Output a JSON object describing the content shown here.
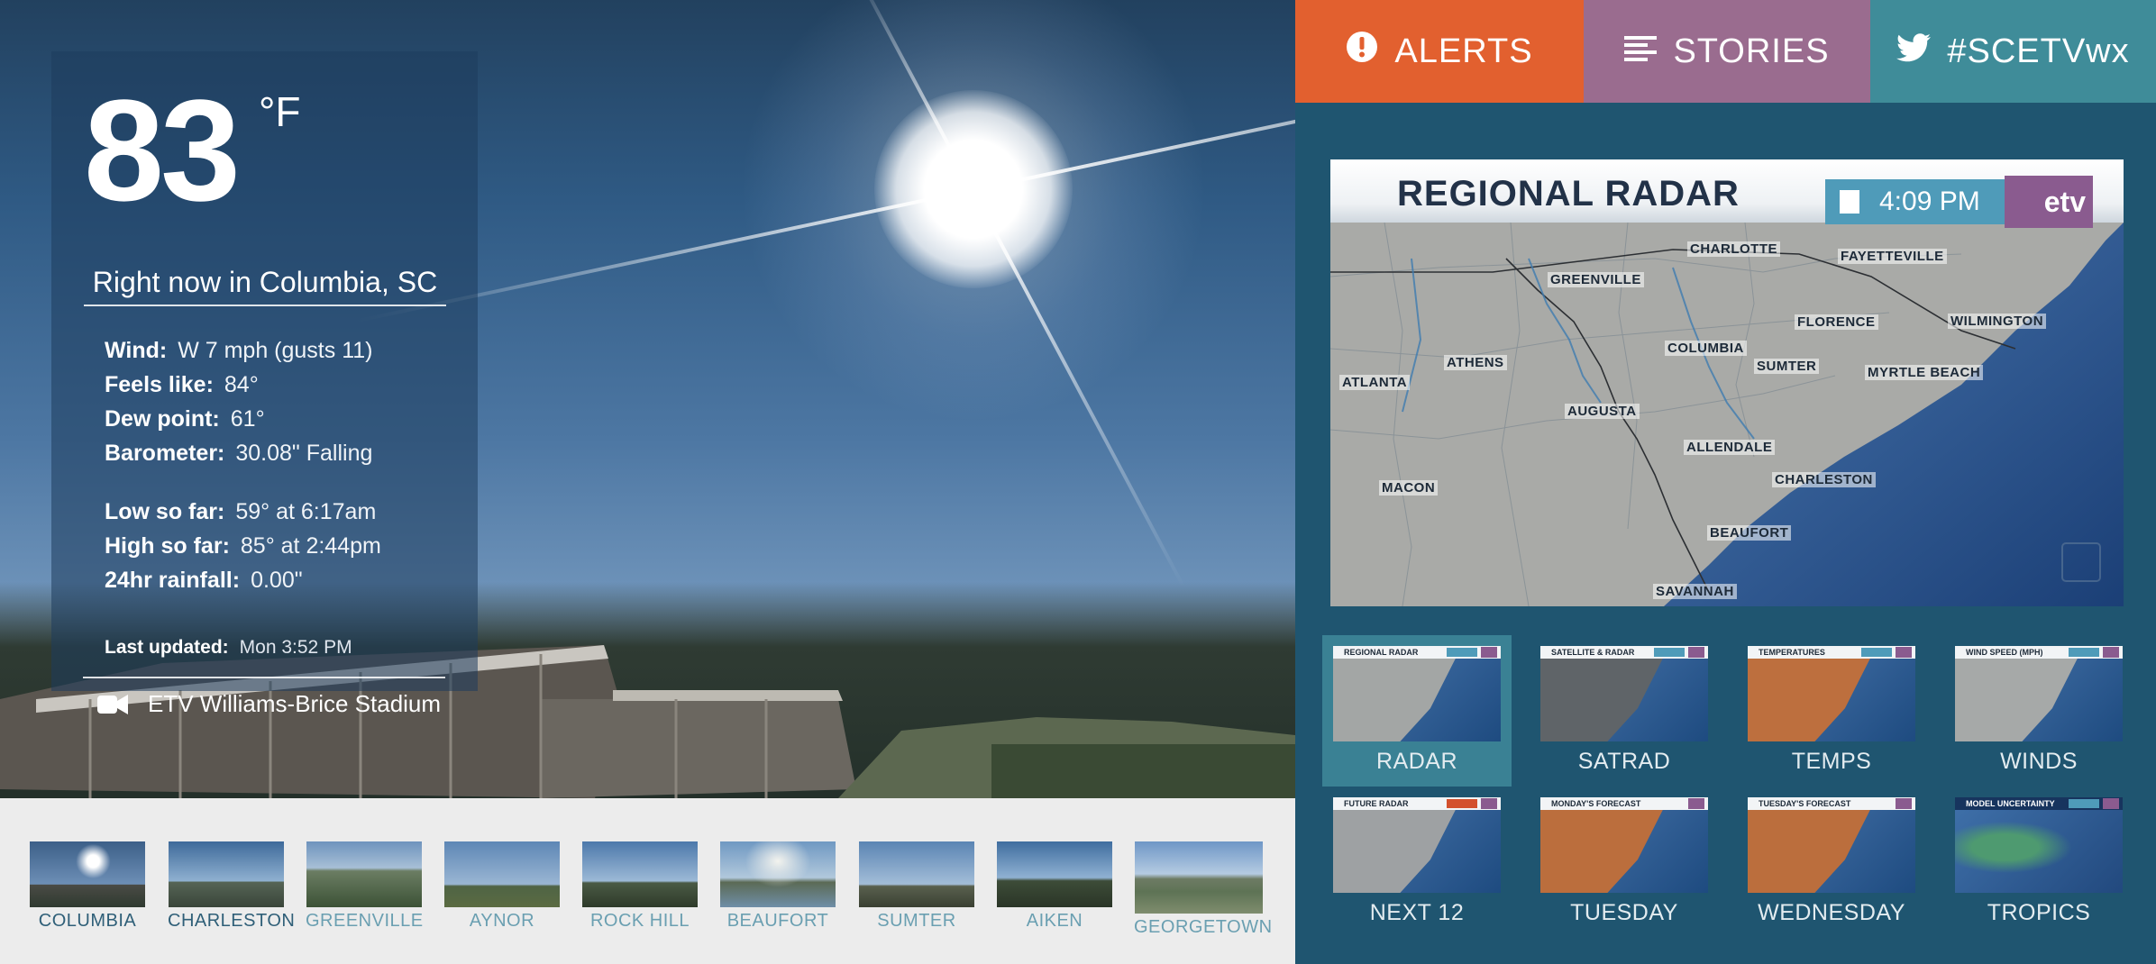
{
  "current": {
    "temperature": "83",
    "unit": "°F",
    "location_line": "Right now in Columbia, SC",
    "wind_label": "Wind:",
    "wind_value": "W 7 mph  (gusts 11)",
    "feels_label": "Feels like:",
    "feels_value": "84°",
    "dew_label": "Dew point:",
    "dew_value": "61°",
    "baro_label": "Barometer:",
    "baro_value": "30.08\"  Falling",
    "low_label": "Low so far:",
    "low_value": "59° at 6:17am",
    "high_label": "High so far:",
    "high_value": "85° at 2:44pm",
    "rain_label": "24hr rainfall:",
    "rain_value": "0.00\"",
    "updated_label": "Last updated:",
    "updated_value": "Mon 3:52 PM",
    "camera_name": "ETV Williams-Brice Stadium"
  },
  "webcams": [
    {
      "label": "COLUMBIA",
      "active": true
    },
    {
      "label": "CHARLESTON",
      "active": false
    },
    {
      "label": "GREENVILLE",
      "active": false
    },
    {
      "label": "AYNOR",
      "active": false
    },
    {
      "label": "ROCK HILL",
      "active": false
    },
    {
      "label": "BEAUFORT",
      "active": false
    },
    {
      "label": "SUMTER",
      "active": false
    },
    {
      "label": "AIKEN",
      "active": false
    },
    {
      "label": "GEORGETOWN",
      "active": false
    }
  ],
  "tabs": {
    "alerts": "ALERTS",
    "stories": "STORIES",
    "twitter": "#SCETVwx"
  },
  "colors": {
    "alerts": "#e2602f",
    "stories": "#9a6c8f",
    "twitter": "#3f8c99",
    "panel_bg": "#1f5570",
    "active_tile": "#3a8194"
  },
  "radar": {
    "title": "REGIONAL RADAR",
    "time": "4:09 PM",
    "logo": "etv",
    "cities": [
      "CHARLOTTE",
      "FAYETTEVILLE",
      "GREENVILLE",
      "FLORENCE",
      "WILMINGTON",
      "COLUMBIA",
      "ATHENS",
      "SUMTER",
      "MYRTLE BEACH",
      "ATLANTA",
      "AUGUSTA",
      "ALLENDALE",
      "CHARLESTON",
      "MACON",
      "BEAUFORT",
      "SAVANNAH"
    ]
  },
  "maps": [
    {
      "label": "RADAR",
      "header": "REGIONAL RADAR",
      "kind": "radar",
      "active": true
    },
    {
      "label": "SATRAD",
      "header": "SATELLITE & RADAR",
      "kind": "sat",
      "active": false
    },
    {
      "label": "TEMPS",
      "header": "TEMPERATURES",
      "kind": "temps",
      "active": false
    },
    {
      "label": "WINDS",
      "header": "WIND SPEED (MPH)",
      "kind": "radar",
      "active": false
    },
    {
      "label": "NEXT 12",
      "header": "FUTURE RADAR",
      "kind": "radar",
      "active": false
    },
    {
      "label": "TUESDAY",
      "header": "MONDAY'S FORECAST",
      "kind": "temps",
      "active": false
    },
    {
      "label": "WEDNESDAY",
      "header": "TUESDAY'S FORECAST",
      "kind": "temps",
      "active": false
    },
    {
      "label": "TROPICS",
      "header": "MODEL UNCERTAINTY",
      "kind": "tropics",
      "active": false
    }
  ],
  "icons": {
    "alerts": "exclamation-circle-icon",
    "stories": "list-lines-icon",
    "twitter": "twitter-bird-icon",
    "camera": "video-camera-icon"
  }
}
